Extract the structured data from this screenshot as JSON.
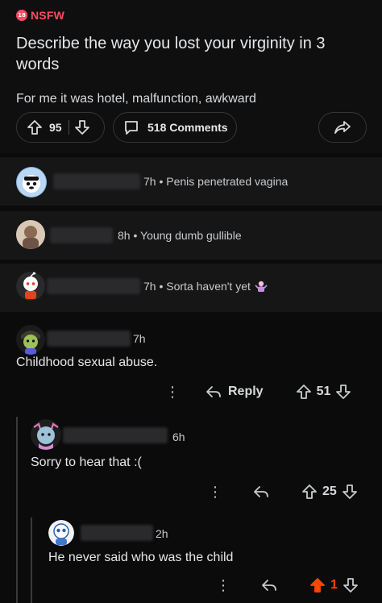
{
  "post": {
    "nsfw_badge_icon_text": "18",
    "nsfw_label": "NSFW",
    "title": "Describe the way you lost your virginity in 3 words",
    "body": "For me it was hotel, malfunction, awkward",
    "vote_count": "95",
    "comment_count_label": "518 Comments"
  },
  "collapsed_comments": [
    {
      "age": "7h",
      "separator": "•",
      "preview": "Penis penetrated vagina"
    },
    {
      "age": "8h",
      "separator": "•",
      "preview": "Young dumb gullible"
    },
    {
      "age": "7h",
      "separator": "•",
      "preview": "Sorta haven't yet"
    }
  ],
  "thread": [
    {
      "age": "7h",
      "text": "Childhood sexual abuse.",
      "reply_label": "Reply",
      "score": "51"
    },
    {
      "age": "6h",
      "text": "Sorry to hear that :(",
      "score": "25"
    },
    {
      "age": "2h",
      "text": "He never said who was the child",
      "score": "1"
    }
  ],
  "colors": {
    "accent_nsfw": "#ff4b62",
    "upvoted": "#ff4500",
    "background": "#0b0b0b"
  },
  "icons": {
    "upvote": "upvote-arrow-icon",
    "downvote": "downvote-arrow-icon",
    "comment": "comment-bubble-icon",
    "share": "share-arrow-icon",
    "reply": "reply-arrow-icon",
    "more": "more-dots-icon"
  }
}
